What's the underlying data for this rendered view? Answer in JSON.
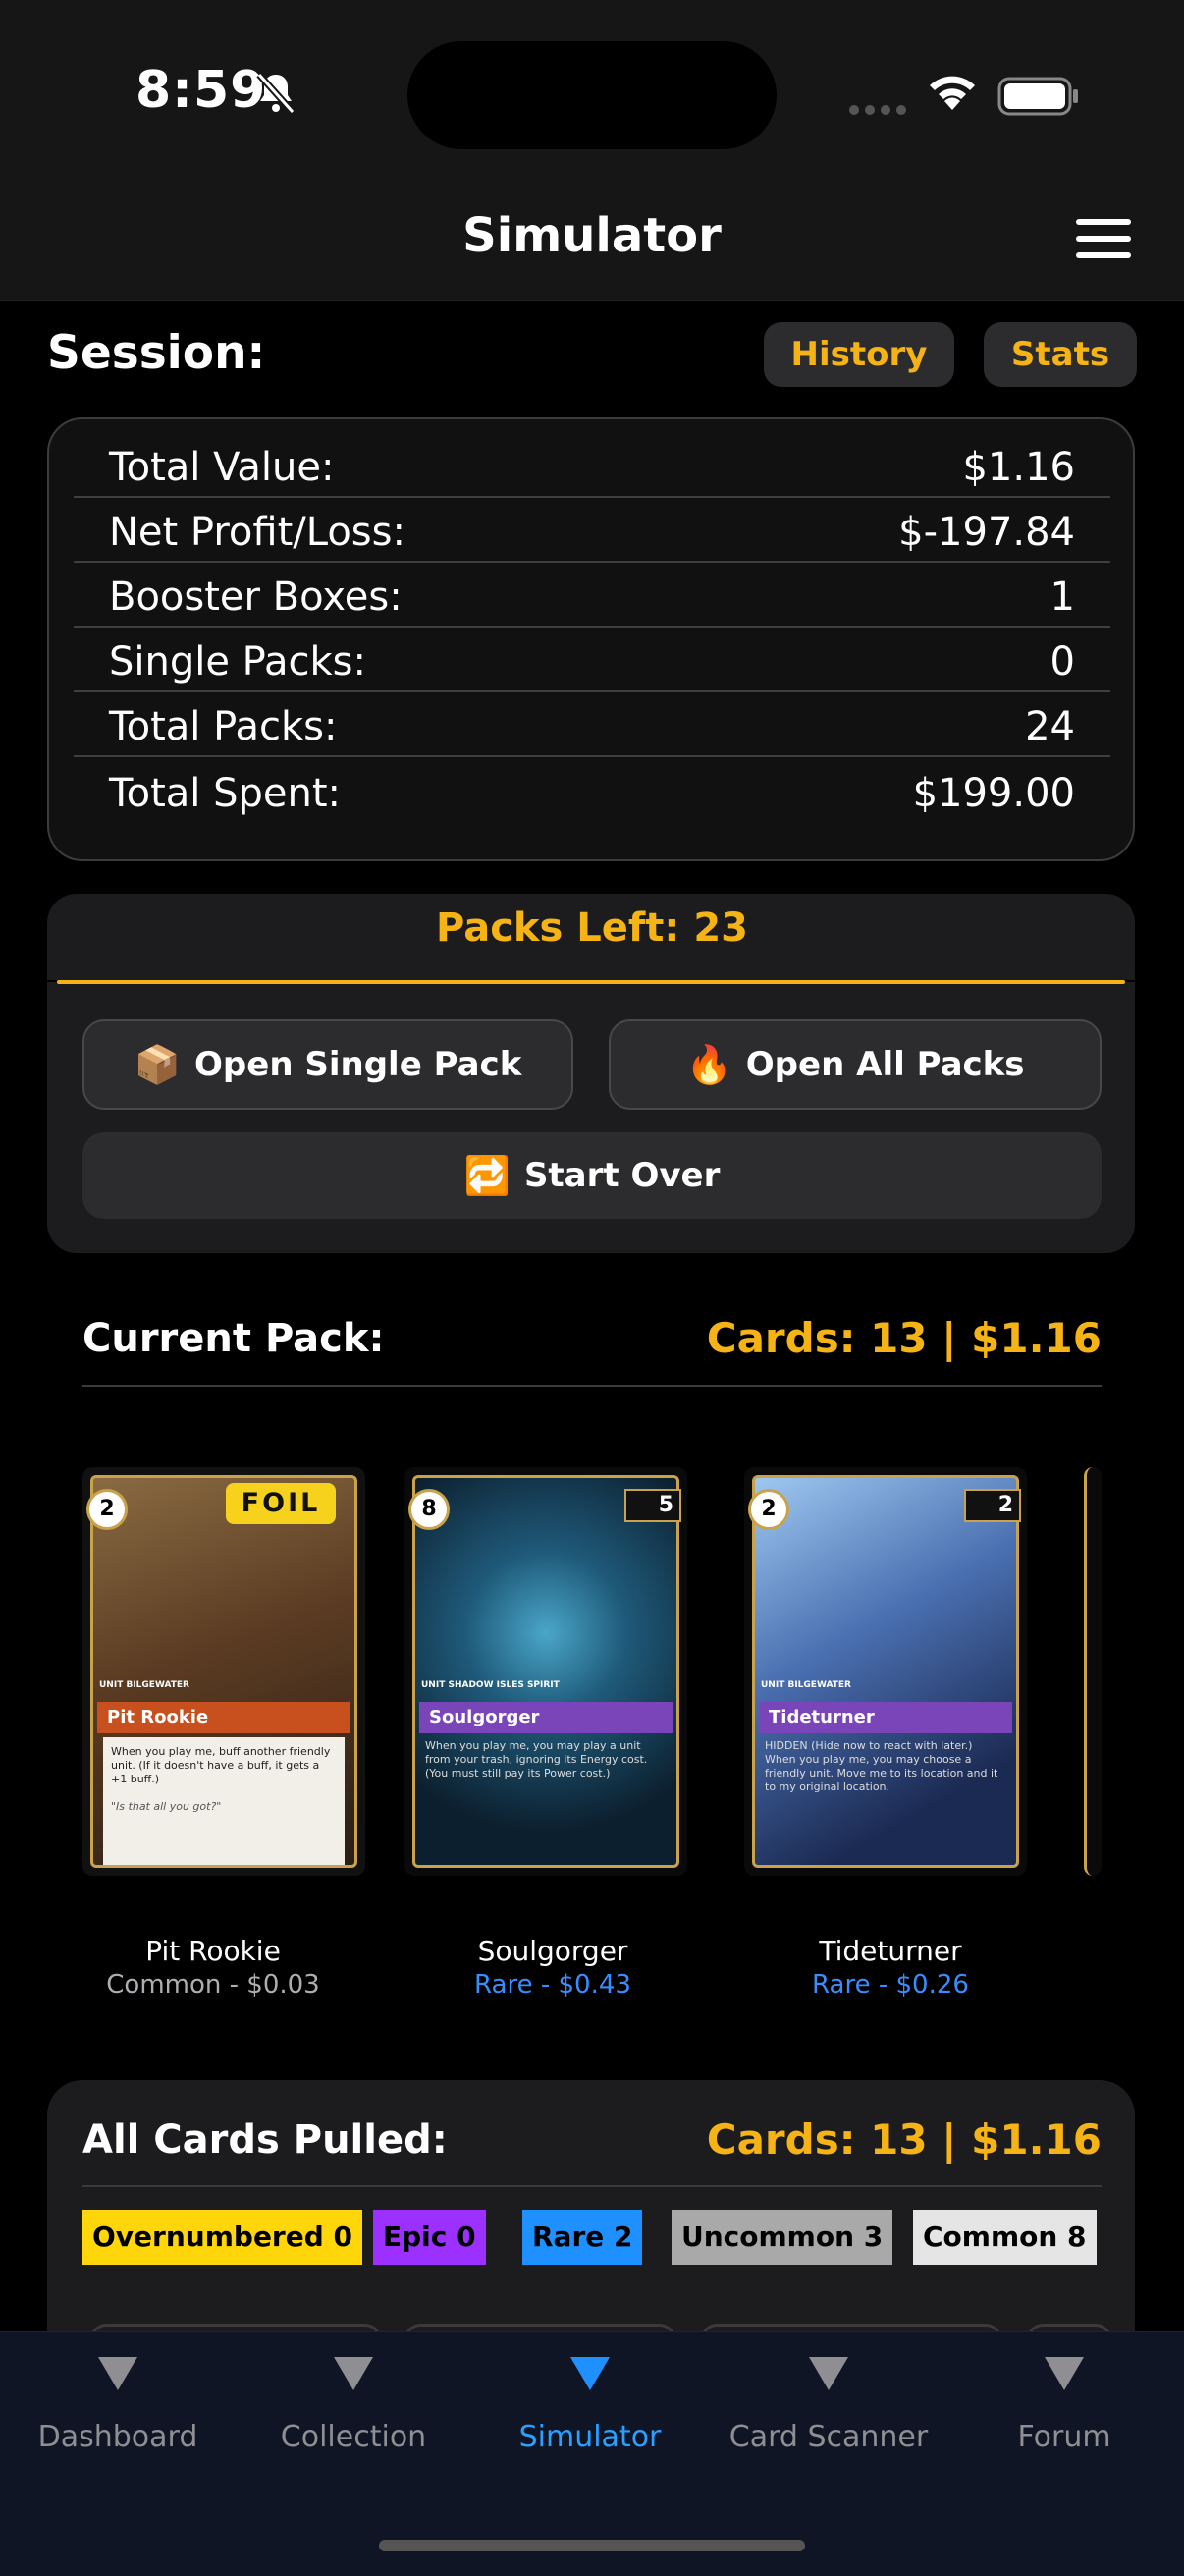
{
  "status_bar": {
    "time": "8:59"
  },
  "nav": {
    "title": "Simulator"
  },
  "session": {
    "label": "Session:",
    "history_label": "History",
    "stats_label": "Stats",
    "rows": [
      {
        "label": "Total Value:",
        "value": "$1.16"
      },
      {
        "label": "Net Profit/Loss:",
        "value": "$-197.84"
      },
      {
        "label": "Booster Boxes:",
        "value": "1"
      },
      {
        "label": "Single Packs:",
        "value": "0"
      },
      {
        "label": "Total Packs:",
        "value": "24"
      },
      {
        "label": "Total Spent:",
        "value": "$199.00"
      }
    ]
  },
  "packs_left": "Packs Left: 23",
  "actions": {
    "open_single": "Open Single Pack",
    "open_single_emoji": "📦",
    "open_all": "Open All Packs",
    "open_all_emoji": "🔥",
    "start_over": "Start Over",
    "start_over_emoji": "🔁"
  },
  "current_pack": {
    "label": "Current Pack:",
    "summary": "Cards: 13 | $1.16",
    "cards": [
      {
        "name": "Pit Rookie",
        "meta": "Common - $0.03",
        "rarity_color": "#aeaeb2",
        "foil": "FOIL",
        "cost": "2",
        "power": "",
        "band_color": "#c8501e",
        "art_a": "#6b4a2c",
        "art_b": "#2a1e16",
        "text": "When you play me, buff another friendly unit. (If it doesn't have a buff, it gets a +1 buff.)",
        "flavor": "\"Is that all you got?\"",
        "tags": "UNIT  BILGEWATER"
      },
      {
        "name": "Soulgorger",
        "meta": "Rare - $0.43",
        "rarity_color": "#3a8dff",
        "foil": "",
        "cost": "8",
        "power": "5",
        "band_color": "#7a45b8",
        "art_a": "#1f5a7a",
        "art_b": "#0c1f2e",
        "text": "When you play me, you may play a unit from your trash, ignoring its Energy cost. (You must still pay its Power cost.)",
        "flavor": "",
        "tags": "UNIT  SHADOW ISLES  SPIRIT"
      },
      {
        "name": "Tideturner",
        "meta": "Rare - $0.26",
        "rarity_color": "#3a8dff",
        "foil": "",
        "cost": "2",
        "power": "2",
        "band_color": "#7a45b8",
        "art_a": "#4a6fb0",
        "art_b": "#1b2a52",
        "text": "HIDDEN (Hide now to react with later.) When you play me, you may choose a friendly unit. Move me to its location and it to my original location.",
        "flavor": "",
        "tags": "UNIT  BILGEWATER"
      }
    ]
  },
  "all_cards": {
    "label": "All Cards Pulled:",
    "summary": "Cards: 13 | $1.16",
    "rarities": [
      {
        "label": "Overnumbered 0",
        "bg": "#ffd60a",
        "fg": "#000"
      },
      {
        "label": "Epic 0",
        "bg": "#9b30ff",
        "fg": "#000"
      },
      {
        "label": "Rare 2",
        "bg": "#1e90ff",
        "fg": "#000"
      },
      {
        "label": "Uncommon 3",
        "bg": "#a9a9a9",
        "fg": "#000"
      },
      {
        "label": "Common 8",
        "bg": "#e5e5e5",
        "fg": "#000"
      }
    ]
  },
  "tabs": [
    {
      "label": "Dashboard",
      "active": false
    },
    {
      "label": "Collection",
      "active": false
    },
    {
      "label": "Simulator",
      "active": true
    },
    {
      "label": "Card Scanner",
      "active": false
    },
    {
      "label": "Forum",
      "active": false
    }
  ]
}
